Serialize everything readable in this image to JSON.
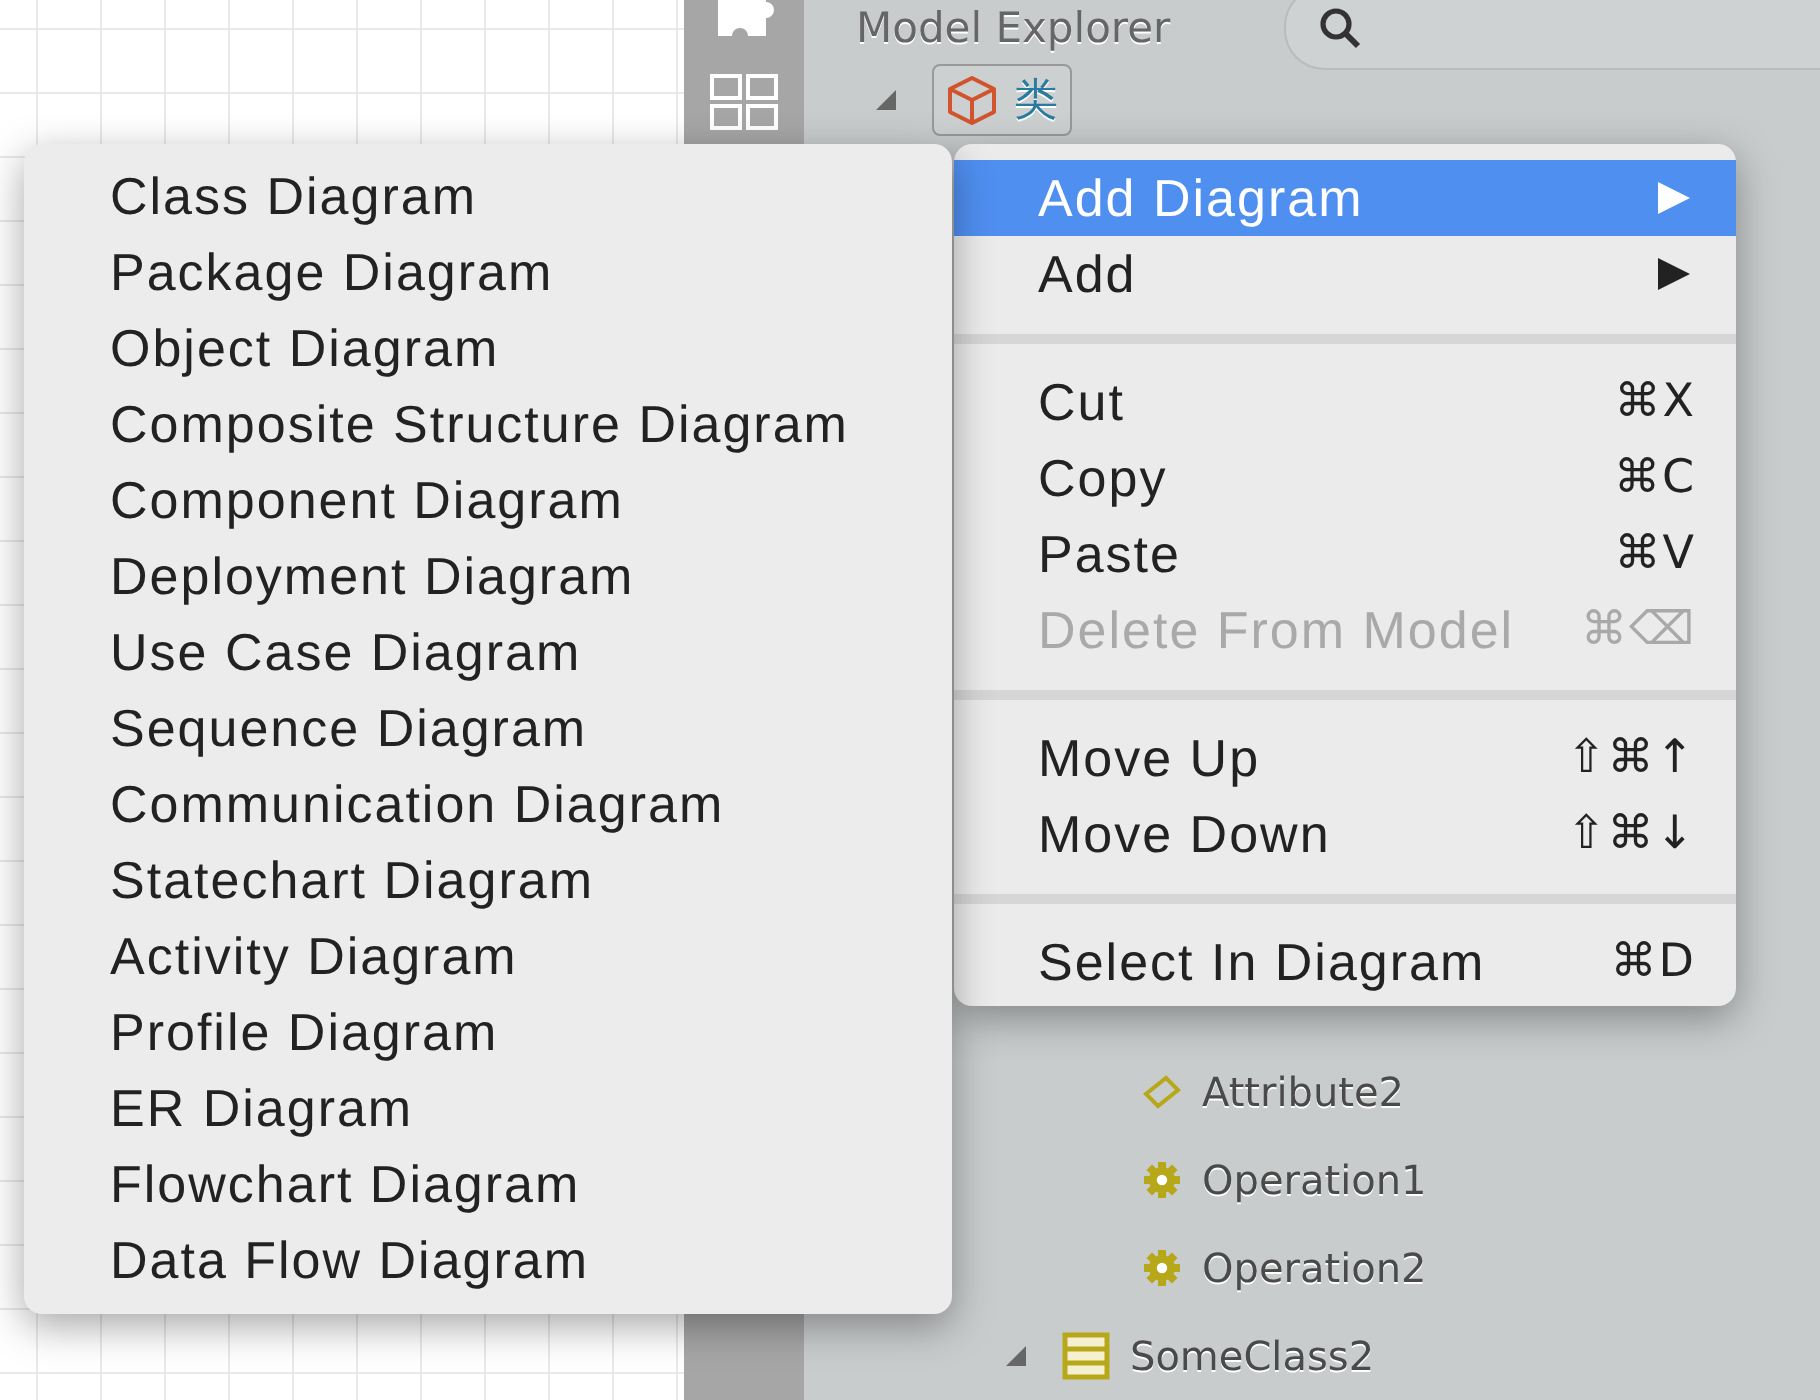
{
  "explorer": {
    "title": "Model Explorer",
    "tree": [
      {
        "label": "类",
        "kind": "model",
        "expanded": true,
        "selected": true,
        "children": [
          {
            "children": [
              {
                "label": "Attribute2",
                "kind": "attribute",
                "selected": false
              },
              {
                "label": "Operation1",
                "kind": "operation",
                "selected": false
              },
              {
                "label": "Operation2",
                "kind": "operation",
                "selected": false
              }
            ]
          },
          {
            "label": "SomeClass2",
            "kind": "class",
            "expanded": true,
            "selected": false
          }
        ]
      }
    ]
  },
  "context_menu": {
    "items": [
      {
        "kind": "item",
        "label": "Add Diagram",
        "submenu": true,
        "selected": true,
        "disabled": false
      },
      {
        "kind": "item",
        "label": "Add",
        "submenu": true,
        "selected": false,
        "disabled": false
      },
      {
        "kind": "separator"
      },
      {
        "kind": "item",
        "label": "Cut",
        "shortcut": "⌘X",
        "selected": false,
        "disabled": false
      },
      {
        "kind": "item",
        "label": "Copy",
        "shortcut": "⌘C",
        "selected": false,
        "disabled": false
      },
      {
        "kind": "item",
        "label": "Paste",
        "shortcut": "⌘V",
        "selected": false,
        "disabled": false
      },
      {
        "kind": "item",
        "label": "Delete From Model",
        "shortcut": "⌘⌫",
        "selected": false,
        "disabled": true
      },
      {
        "kind": "separator"
      },
      {
        "kind": "item",
        "label": "Move Up",
        "shortcut": "⇧⌘↑",
        "selected": false,
        "disabled": false
      },
      {
        "kind": "item",
        "label": "Move Down",
        "shortcut": "⇧⌘↓",
        "selected": false,
        "disabled": false
      },
      {
        "kind": "separator"
      },
      {
        "kind": "item",
        "label": "Select In Diagram",
        "shortcut": "⌘D",
        "selected": false,
        "disabled": false
      }
    ]
  },
  "submenu": {
    "items": [
      {
        "label": "Class Diagram"
      },
      {
        "label": "Package Diagram"
      },
      {
        "label": "Object Diagram"
      },
      {
        "label": "Composite Structure Diagram"
      },
      {
        "label": "Component Diagram"
      },
      {
        "label": "Deployment Diagram"
      },
      {
        "label": "Use Case Diagram"
      },
      {
        "label": "Sequence Diagram"
      },
      {
        "label": "Communication Diagram"
      },
      {
        "label": "Statechart Diagram"
      },
      {
        "label": "Activity Diagram"
      },
      {
        "label": "Profile Diagram"
      },
      {
        "label": "ER Diagram"
      },
      {
        "label": "Flowchart Diagram"
      },
      {
        "label": "Data Flow Diagram"
      }
    ]
  }
}
